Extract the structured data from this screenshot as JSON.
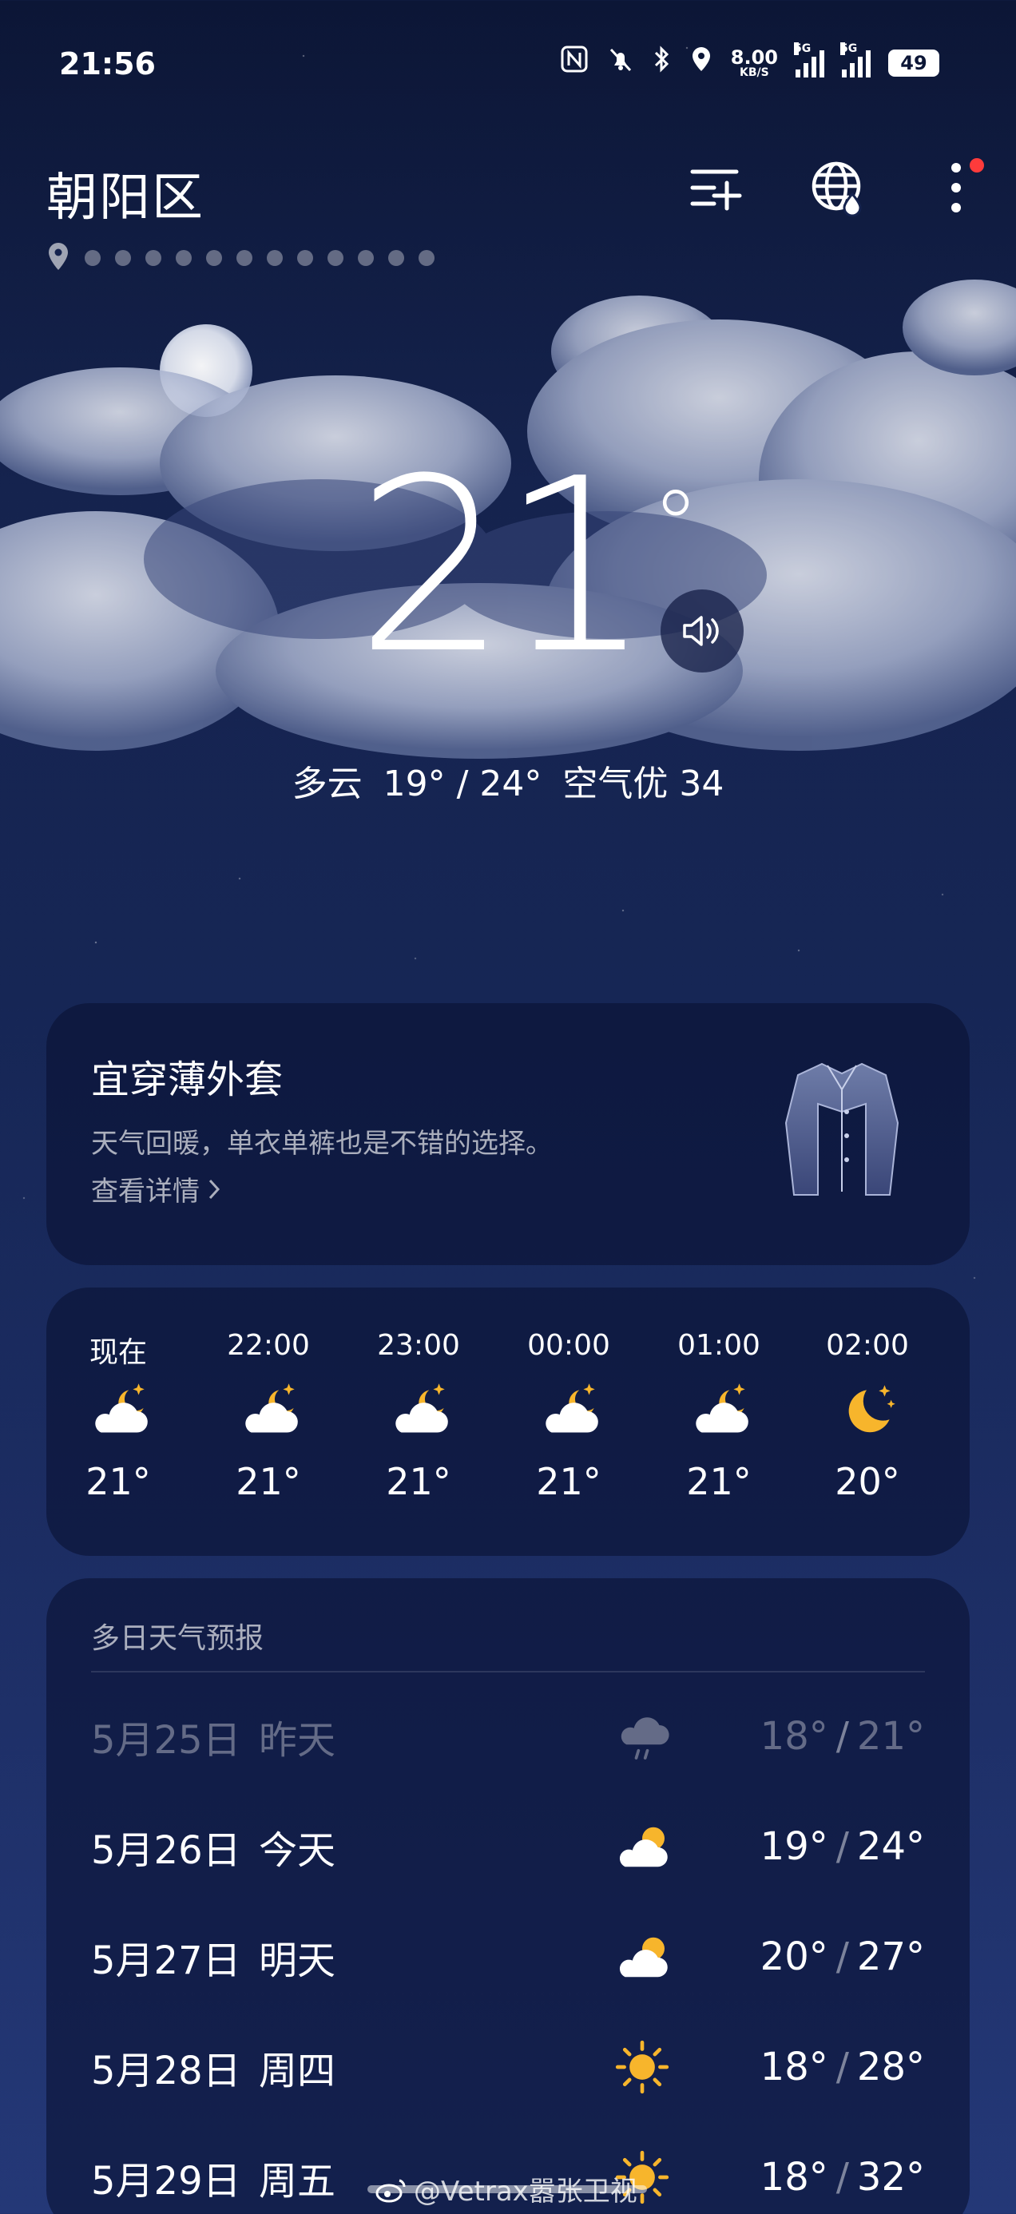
{
  "status_bar": {
    "time": "21:56",
    "net_speed_value": "8.00",
    "net_speed_unit": "KB/S",
    "signal1_label": "5G",
    "signal2_label": "5G",
    "battery": "49",
    "icons": [
      "nfc-icon",
      "mute-icon",
      "bluetooth-icon",
      "location-icon",
      "signal-icon",
      "signal-icon",
      "battery-icon"
    ]
  },
  "header": {
    "location": "朝阳区",
    "pages": 12,
    "actions": [
      "city-list-add-icon",
      "globe-icon",
      "more-icon"
    ]
  },
  "current": {
    "temperature": "21",
    "degree": "°",
    "condition": "多云",
    "range": "19° / 24°",
    "air_quality": "空气优 34"
  },
  "clothes": {
    "title": "宜穿薄外套",
    "description": "天气回暖，单衣单裤也是不错的选择。",
    "link": "查看详情"
  },
  "hourly": [
    {
      "time": "现在",
      "icon": "partly-cloudy-night-icon",
      "temp": "21°"
    },
    {
      "time": "22:00",
      "icon": "partly-cloudy-night-icon",
      "temp": "21°"
    },
    {
      "time": "23:00",
      "icon": "partly-cloudy-night-icon",
      "temp": "21°"
    },
    {
      "time": "00:00",
      "icon": "partly-cloudy-night-icon",
      "temp": "21°"
    },
    {
      "time": "01:00",
      "icon": "partly-cloudy-night-icon",
      "temp": "21°"
    },
    {
      "time": "02:00",
      "icon": "clear-night-icon",
      "temp": "20°"
    }
  ],
  "daily": {
    "title": "多日天气预报",
    "days": [
      {
        "date": "5月25日",
        "name": "昨天",
        "icon": "rain-icon",
        "low": "18°",
        "high": "21°",
        "past": true
      },
      {
        "date": "5月26日",
        "name": "今天",
        "icon": "partly-cloudy-day-icon",
        "low": "19°",
        "high": "24°"
      },
      {
        "date": "5月27日",
        "name": "明天",
        "icon": "partly-cloudy-day-icon",
        "low": "20°",
        "high": "27°"
      },
      {
        "date": "5月28日",
        "name": "周四",
        "icon": "sunny-icon",
        "low": "18°",
        "high": "28°"
      },
      {
        "date": "5月29日",
        "name": "周五",
        "icon": "sunny-icon",
        "low": "18°",
        "high": "32°"
      }
    ],
    "separator": "/"
  },
  "watermark": "@Vetrax嚣张卫视",
  "colors": {
    "accent_sun": "#f7b52c",
    "notification_dot": "#ff3b3b",
    "background_top": "#0c1636"
  }
}
